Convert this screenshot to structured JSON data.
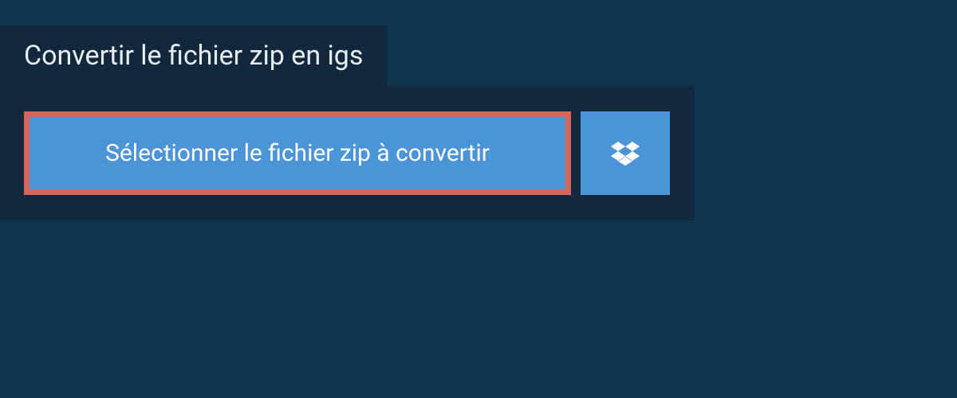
{
  "header": {
    "title": "Convertir le fichier zip en igs"
  },
  "actions": {
    "select_file_label": "Sélectionner le fichier zip à convertir"
  },
  "colors": {
    "bg_outer": "#0f344f",
    "bg_panel": "#12283c",
    "button_bg": "#4b94d8",
    "button_border_highlight": "#d96459",
    "text_light": "#e8eef3"
  }
}
